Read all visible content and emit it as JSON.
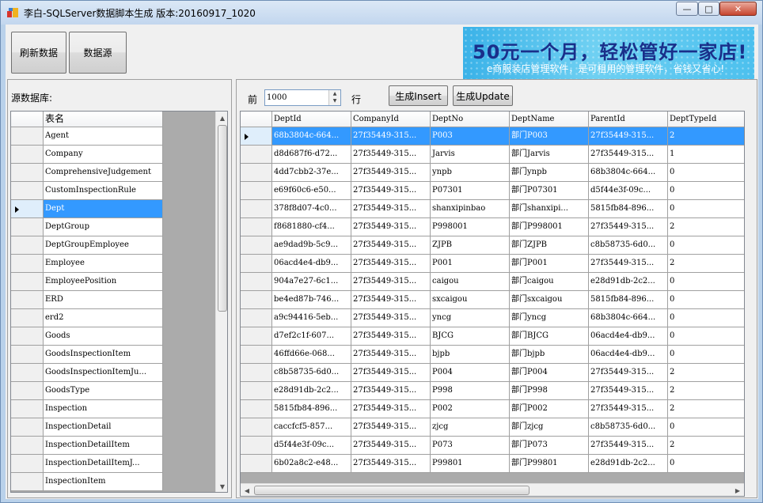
{
  "window": {
    "title": "李白-SQLServer数据脚本生成 版本:20160917_1020",
    "minimize_glyph": "—",
    "maximize_glyph": "□",
    "close_glyph": "✕"
  },
  "toolbar": {
    "refresh_label": "刷新数据",
    "datasource_label": "数据源"
  },
  "banner": {
    "headline": "50元一个月，轻松管好一家店!",
    "subline": "e商服装店管理软件，是可租用的管理软件，省钱又省心!"
  },
  "source_panel": {
    "label": "源数据库:",
    "column_header": "表名",
    "selected_index": 4,
    "tables": [
      "Agent",
      "Company",
      "ComprehensiveJudgement",
      "CustomInspectionRule",
      "Dept",
      "DeptGroup",
      "DeptGroupEmployee",
      "Employee",
      "EmployeePosition",
      "ERD",
      "erd2",
      "Goods",
      "GoodsInspectionItem",
      "GoodsInspectionItemJu...",
      "GoodsType",
      "Inspection",
      "InspectionDetail",
      "InspectionDetailItem",
      "InspectionDetailItemJ...",
      "InspectionItem"
    ]
  },
  "controls": {
    "top_prefix": "前",
    "top_value": "1000",
    "top_suffix": "行",
    "gen_insert_label": "生成Insert",
    "gen_update_label": "生成Update",
    "spin_up": "▲",
    "spin_down": "▼"
  },
  "data_grid": {
    "columns": [
      "DeptId",
      "CompanyId",
      "DeptNo",
      "DeptName",
      "ParentId",
      "DeptTypeId"
    ],
    "selected_index": 0,
    "rows": [
      [
        "68b3804c-664...",
        "27f35449-315...",
        "P003",
        "部门P003",
        "27f35449-315...",
        "2"
      ],
      [
        "d8d687f6-d72...",
        "27f35449-315...",
        "Jarvis",
        "部门Jarvis",
        "27f35449-315...",
        "1"
      ],
      [
        "4dd7cbb2-37e...",
        "27f35449-315...",
        "ynpb",
        "部门ynpb",
        "68b3804c-664...",
        "0"
      ],
      [
        "e69f60c6-e50...",
        "27f35449-315...",
        "P07301",
        "部门P07301",
        "d5f44e3f-09c...",
        "0"
      ],
      [
        "378f8d07-4c0...",
        "27f35449-315...",
        "shanxipinbao",
        "部门shanxipi...",
        "5815fb84-896...",
        "0"
      ],
      [
        "f8681880-cf4...",
        "27f35449-315...",
        "P998001",
        "部门P998001",
        "27f35449-315...",
        "2"
      ],
      [
        "ae9dad9b-5c9...",
        "27f35449-315...",
        "ZJPB",
        "部门ZJPB",
        "c8b58735-6d0...",
        "0"
      ],
      [
        "06acd4e4-db9...",
        "27f35449-315...",
        "P001",
        "部门P001",
        "27f35449-315...",
        "2"
      ],
      [
        "904a7e27-6c1...",
        "27f35449-315...",
        "caigou",
        "部门caigou",
        "e28d91db-2c2...",
        "0"
      ],
      [
        "be4ed87b-746...",
        "27f35449-315...",
        "sxcaigou",
        "部门sxcaigou",
        "5815fb84-896...",
        "0"
      ],
      [
        "a9c94416-5eb...",
        "27f35449-315...",
        "yncg",
        "部门yncg",
        "68b3804c-664...",
        "0"
      ],
      [
        "d7ef2c1f-607...",
        "27f35449-315...",
        "BJCG",
        "部门BJCG",
        "06acd4e4-db9...",
        "0"
      ],
      [
        "46ffd66e-068...",
        "27f35449-315...",
        "bjpb",
        "部门bjpb",
        "06acd4e4-db9...",
        "0"
      ],
      [
        "c8b58735-6d0...",
        "27f35449-315...",
        "P004",
        "部门P004",
        "27f35449-315...",
        "2"
      ],
      [
        "e28d91db-2c2...",
        "27f35449-315...",
        "P998",
        "部门P998",
        "27f35449-315...",
        "2"
      ],
      [
        "5815fb84-896...",
        "27f35449-315...",
        "P002",
        "部门P002",
        "27f35449-315...",
        "2"
      ],
      [
        "caccfcf5-857...",
        "27f35449-315...",
        "zjcg",
        "部门zjcg",
        "c8b58735-6d0...",
        "0"
      ],
      [
        "d5f44e3f-09c...",
        "27f35449-315...",
        "P073",
        "部门P073",
        "27f35449-315...",
        "2"
      ],
      [
        "6b02a8c2-e48...",
        "27f35449-315...",
        "P99801",
        "部门P99801",
        "e28d91db-2c2...",
        "0"
      ]
    ]
  },
  "colors": {
    "selection": "#3399ff",
    "grid_background": "#ababab",
    "banner_text": "#1a2f8a"
  }
}
